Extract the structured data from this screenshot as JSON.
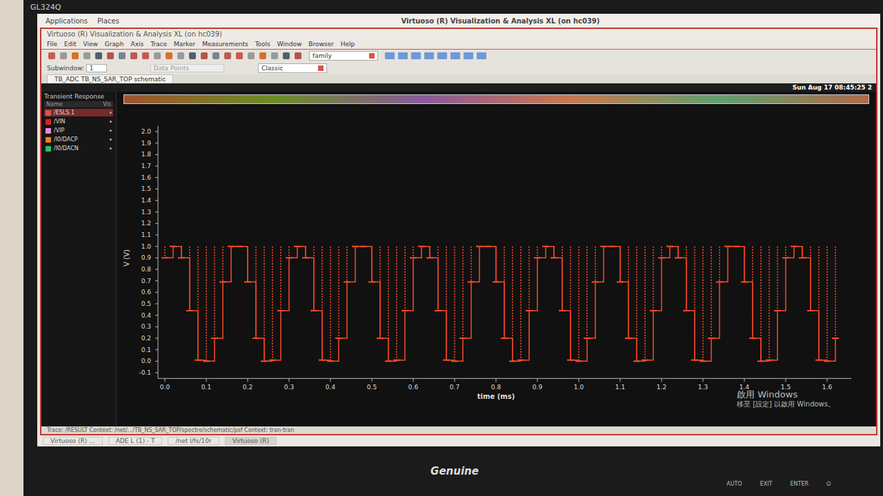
{
  "monitor": {
    "model": "GL324Q",
    "brand": "Genuine",
    "buttons": [
      "AUTO",
      "EXIT",
      "ENTER",
      "⏻"
    ]
  },
  "desktop_bar": {
    "menus": [
      "Applications",
      "Places"
    ],
    "title": "Virtuoso (R) Visualization & Analysis XL (on hc039)"
  },
  "window": {
    "title": "Virtuoso (R) Visualization & Analysis XL (on hc039)"
  },
  "menubar": [
    "File",
    "Edit",
    "View",
    "Graph",
    "Axis",
    "Trace",
    "Marker",
    "Measurements",
    "Tools",
    "Window",
    "Browser",
    "Help"
  ],
  "toolbar": {
    "family_select": "family",
    "subwindow_label": "Subwindow:",
    "subwindow_value": "1",
    "data_points": "Data Points",
    "style_select": "Classic"
  },
  "tabs": [
    {
      "label": "TB_ADC TB_NS_SAR_TOP schematic",
      "selected": true
    }
  ],
  "clock": "Sun Aug 17 08:45:25 2",
  "graph": {
    "title": "Transient Response",
    "legend_header": [
      "Name",
      "Vis"
    ],
    "legend": [
      {
        "name": "/ESLS.1",
        "selected": true,
        "color": "#d9534f"
      },
      {
        "name": "/VIN",
        "selected": false,
        "color": "#e02020"
      },
      {
        "name": "/VIP",
        "selected": false,
        "color": "#e58ad8"
      },
      {
        "name": "/I0/DACP",
        "selected": false,
        "color": "#ff7a1a"
      },
      {
        "name": "/I0/DACN",
        "selected": false,
        "color": "#22c55e"
      }
    ],
    "y_axis": {
      "label": "V (V)",
      "ticks": [
        "2.0",
        "1.9",
        "1.8",
        "1.7",
        "1.6",
        "1.5",
        "1.4",
        "1.3",
        "1.2",
        "1.1",
        "1.0",
        "0.9",
        "0.8",
        "0.7",
        "0.6",
        "0.5",
        "0.4",
        "0.3",
        "0.2",
        "0.1",
        "0.0",
        "-0.1"
      ]
    },
    "x_axis": {
      "label": "time (ms)",
      "ticks": [
        "0.0",
        "0.1",
        "0.2",
        "0.3",
        "0.4",
        "0.5",
        "0.6",
        "0.7",
        "0.8",
        "0.9",
        "1.0",
        "1.1",
        "1.2",
        "1.3",
        "1.4",
        "1.5",
        "1.6"
      ]
    },
    "series": [
      {
        "name": "/I0/DACP",
        "color": "#ff4a26",
        "t_step_ms": 0.02,
        "values": [
          0.9,
          1,
          0.9,
          0.44,
          0.01,
          0,
          0.2,
          0.69,
          1,
          1,
          0.69,
          0.2,
          0,
          0.01,
          0.44,
          0.9,
          1,
          0.9,
          0.44,
          0.01,
          0,
          0.2,
          0.69,
          1,
          1,
          0.69,
          0.2,
          0,
          0.01,
          0.44,
          0.9,
          1,
          0.9,
          0.44,
          0.01,
          0,
          0.2,
          0.69,
          1,
          1,
          0.69,
          0.2,
          0,
          0.01,
          0.44,
          0.9,
          1,
          0.9,
          0.44,
          0.01,
          0,
          0.2,
          0.69,
          1,
          1,
          0.69,
          0.2,
          0,
          0.01,
          0.44,
          0.9,
          1,
          0.9,
          0.44,
          0.01,
          0,
          0.2,
          0.69,
          1,
          1,
          0.69,
          0.2,
          0,
          0.01,
          0.44,
          0.9,
          1,
          0.9,
          0.44,
          0.01,
          0,
          0.2
        ]
      }
    ]
  },
  "watermark": [
    "啟用 Windows",
    "移至 [設定] 以啟用 Windows。"
  ],
  "status_bar": "Trace: /RESULT  Context: /net/.../TB_NS_SAR_TOP/spectre/schematic/psf  Context: tran-tran",
  "taskbar": [
    {
      "label": "Virtuoso (R) ...",
      "selected": false
    },
    {
      "label": "ADE L (1) - T",
      "selected": false
    },
    {
      "label": "/net l/fs/10r",
      "selected": false
    },
    {
      "label": "Virtuoso (R)",
      "selected": true
    }
  ]
}
